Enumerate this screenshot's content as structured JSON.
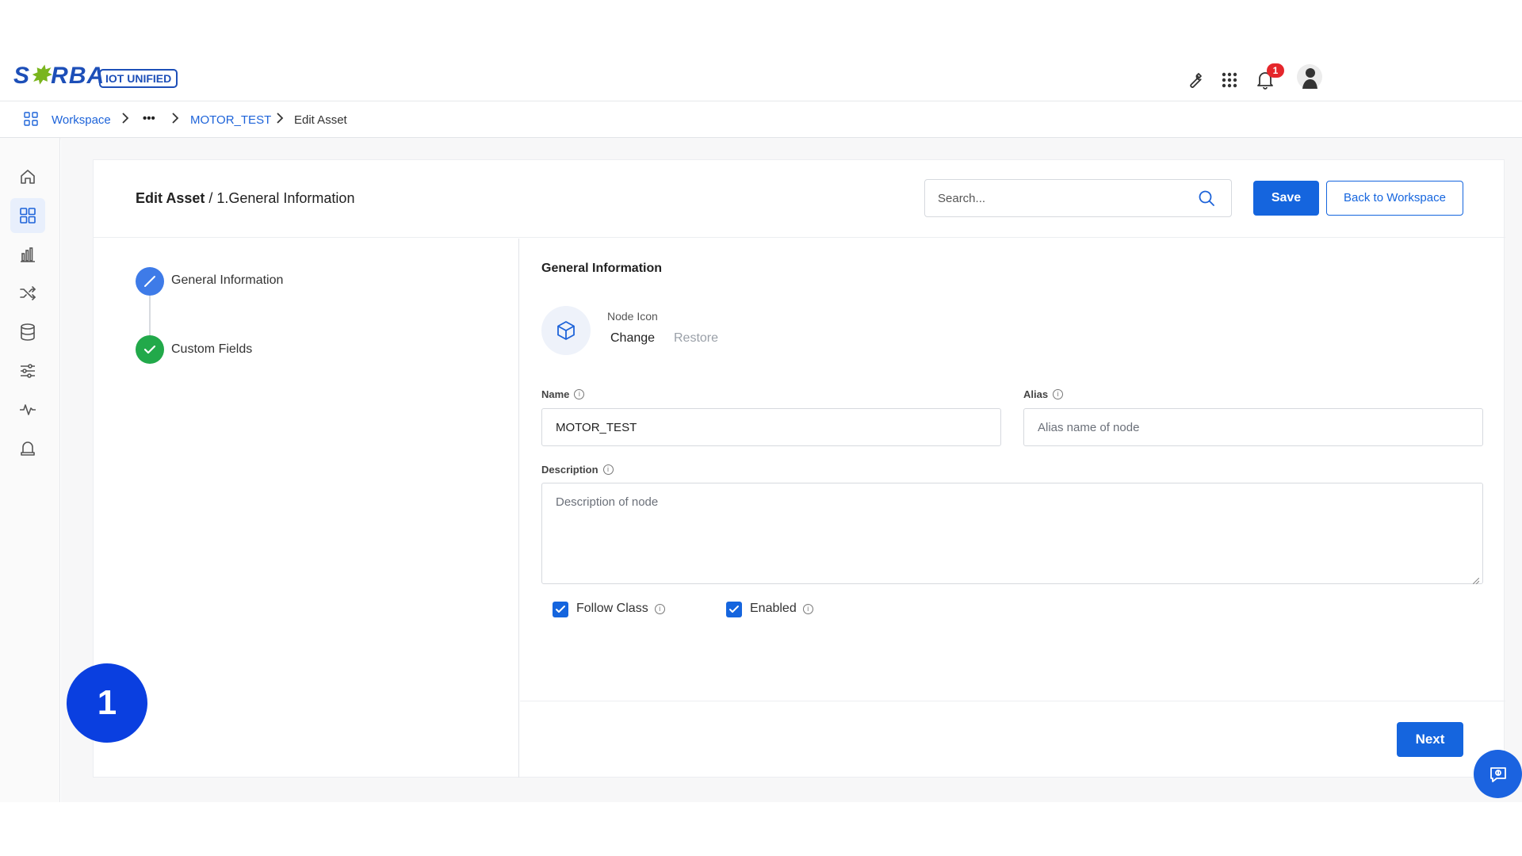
{
  "header": {
    "logo_text": "SORBA",
    "logo_badge": "IOT UNIFIED",
    "icons": [
      "wrench-icon",
      "apps-grid-icon",
      "bell-icon",
      "avatar"
    ],
    "notification_count": "1"
  },
  "breadcrumb": {
    "items": [
      "Workspace",
      "•••",
      "MOTOR_TEST",
      "Edit Asset"
    ]
  },
  "sidebar": {
    "items": [
      "home-icon",
      "workspace-grid-icon",
      "bar-chart-icon",
      "shuffle-icon",
      "database-icon",
      "sliders-icon",
      "pulse-icon",
      "alarm-bell-icon"
    ],
    "active_index": 1
  },
  "page": {
    "title_bold": "Edit Asset",
    "title_rest": " / 1.General Information",
    "search_placeholder": "Search...",
    "save_label": "Save",
    "back_label": "Back to Workspace",
    "next_label": "Next"
  },
  "stepper": {
    "steps": [
      {
        "label": "General Information",
        "state": "editing"
      },
      {
        "label": "Custom Fields",
        "state": "done"
      }
    ]
  },
  "form": {
    "section_title": "General Information",
    "node_icon_label": "Node Icon",
    "change_label": "Change",
    "restore_label": "Restore",
    "name_label": "Name",
    "name_value": "MOTOR_TEST",
    "alias_label": "Alias",
    "alias_placeholder": "Alias name of node",
    "description_label": "Description",
    "description_placeholder": "Description of node",
    "follow_class_label": "Follow Class",
    "follow_class_checked": true,
    "enabled_label": "Enabled",
    "enabled_checked": true
  },
  "overlay": {
    "step_number": "1"
  },
  "colors": {
    "primary": "#1565de",
    "brand": "#1d4fb8",
    "success": "#22a94a",
    "badge": "#e5262b"
  }
}
